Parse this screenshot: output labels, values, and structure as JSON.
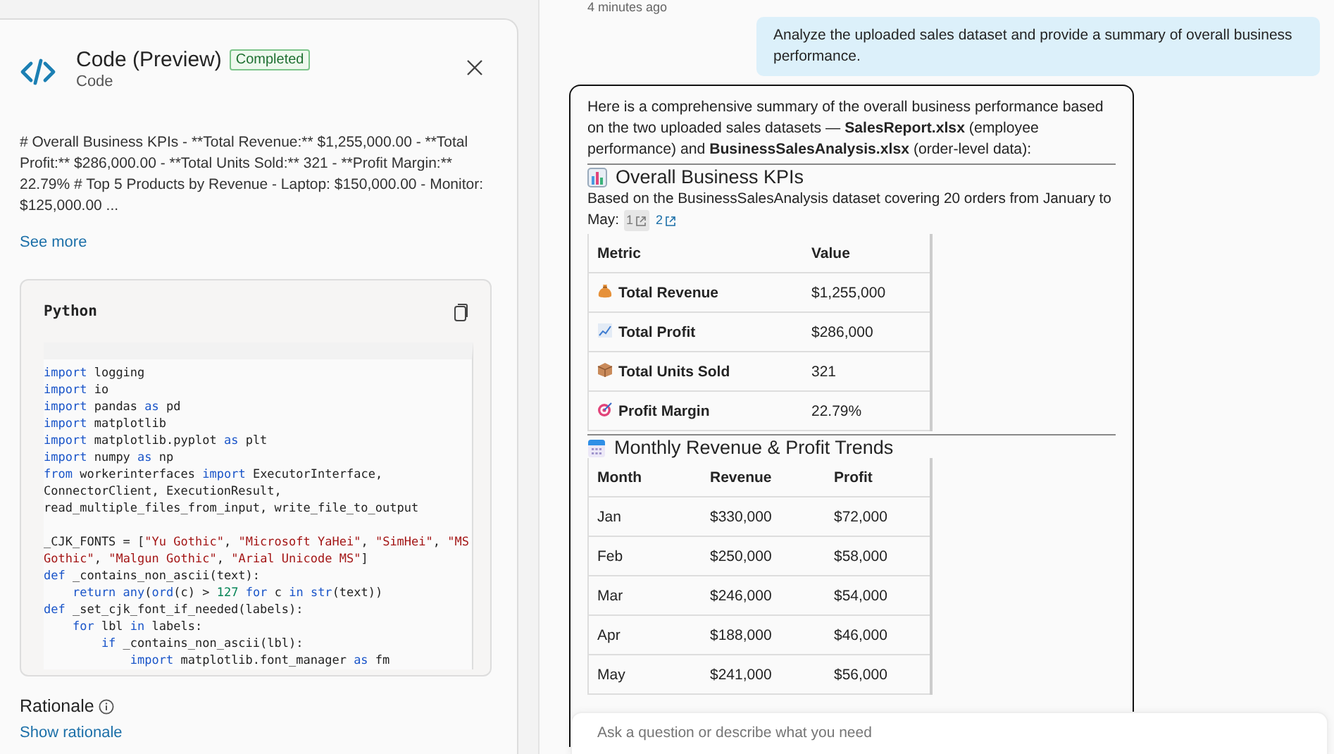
{
  "code_panel": {
    "title": "Code (Preview)",
    "status_badge": "Completed",
    "subtitle": "Code",
    "summary": "# Overall Business KPIs - **Total Revenue:** $1,255,000.00 - **Total Profit:** $286,000.00 - **Total Units Sold:** 321 - **Profit Margin:** 22.79% # Top 5 Products by Revenue - Laptop: $150,000.00 - Monitor: $125,000.00 ...",
    "see_more": "See more",
    "code_block": {
      "language": "Python",
      "lines": [
        {
          "tokens": [
            {
              "kind": "keyword",
              "text": "import"
            },
            {
              "kind": "plain",
              "text": " logging"
            }
          ]
        },
        {
          "tokens": [
            {
              "kind": "keyword",
              "text": "import"
            },
            {
              "kind": "plain",
              "text": " io"
            }
          ]
        },
        {
          "tokens": [
            {
              "kind": "keyword",
              "text": "import"
            },
            {
              "kind": "plain",
              "text": " pandas "
            },
            {
              "kind": "keyword",
              "text": "as"
            },
            {
              "kind": "plain",
              "text": " pd"
            }
          ]
        },
        {
          "tokens": [
            {
              "kind": "keyword",
              "text": "import"
            },
            {
              "kind": "plain",
              "text": " matplotlib"
            }
          ]
        },
        {
          "tokens": [
            {
              "kind": "keyword",
              "text": "import"
            },
            {
              "kind": "plain",
              "text": " matplotlib.pyplot "
            },
            {
              "kind": "keyword",
              "text": "as"
            },
            {
              "kind": "plain",
              "text": " plt"
            }
          ]
        },
        {
          "tokens": [
            {
              "kind": "keyword",
              "text": "import"
            },
            {
              "kind": "plain",
              "text": " numpy "
            },
            {
              "kind": "keyword",
              "text": "as"
            },
            {
              "kind": "plain",
              "text": " np"
            }
          ]
        },
        {
          "tokens": [
            {
              "kind": "keyword",
              "text": "from"
            },
            {
              "kind": "plain",
              "text": " workerinterfaces "
            },
            {
              "kind": "keyword",
              "text": "import"
            },
            {
              "kind": "plain",
              "text": " ExecutorInterface,"
            }
          ]
        },
        {
          "tokens": [
            {
              "kind": "plain",
              "text": "ConnectorClient, ExecutionResult,"
            }
          ]
        },
        {
          "tokens": [
            {
              "kind": "plain",
              "text": "read_multiple_files_from_input, write_file_to_output"
            }
          ]
        },
        {
          "blank_before": true,
          "tokens": [
            {
              "kind": "plain",
              "text": "_CJK_FONTS = ["
            },
            {
              "kind": "string",
              "text": "\"Yu Gothic\""
            },
            {
              "kind": "plain",
              "text": ", "
            },
            {
              "kind": "string",
              "text": "\"Microsoft YaHei\""
            },
            {
              "kind": "plain",
              "text": ", "
            },
            {
              "kind": "string",
              "text": "\"SimHei\""
            },
            {
              "kind": "plain",
              "text": ", "
            },
            {
              "kind": "string",
              "text": "\"MS"
            }
          ]
        },
        {
          "tokens": [
            {
              "kind": "string",
              "text": "Gothic\""
            },
            {
              "kind": "plain",
              "text": ", "
            },
            {
              "kind": "string",
              "text": "\"Malgun Gothic\""
            },
            {
              "kind": "plain",
              "text": ", "
            },
            {
              "kind": "string",
              "text": "\"Arial Unicode MS\""
            },
            {
              "kind": "plain",
              "text": "]"
            }
          ]
        },
        {
          "tokens": [
            {
              "kind": "keyword",
              "text": "def"
            },
            {
              "kind": "plain",
              "text": " _contains_non_ascii(text):"
            }
          ]
        },
        {
          "tokens": [
            {
              "kind": "keyword",
              "text": "    return"
            },
            {
              "kind": "keyword",
              "text": " any"
            },
            {
              "kind": "plain",
              "text": "("
            },
            {
              "kind": "keyword",
              "text": "ord"
            },
            {
              "kind": "plain",
              "text": "(c) > "
            },
            {
              "kind": "number",
              "text": "127"
            },
            {
              "kind": "keyword",
              "text": " for"
            },
            {
              "kind": "plain",
              "text": " c "
            },
            {
              "kind": "keyword",
              "text": "in"
            },
            {
              "kind": "keyword",
              "text": " str"
            },
            {
              "kind": "plain",
              "text": "(text))"
            }
          ]
        },
        {
          "tokens": [
            {
              "kind": "keyword",
              "text": "def"
            },
            {
              "kind": "plain",
              "text": " _set_cjk_font_if_needed(labels):"
            }
          ]
        },
        {
          "tokens": [
            {
              "kind": "keyword",
              "text": "    for"
            },
            {
              "kind": "plain",
              "text": " lbl "
            },
            {
              "kind": "keyword",
              "text": "in"
            },
            {
              "kind": "plain",
              "text": " labels:"
            }
          ]
        },
        {
          "tokens": [
            {
              "kind": "keyword",
              "text": "        if"
            },
            {
              "kind": "plain",
              "text": " _contains_non_ascii(lbl):"
            }
          ]
        },
        {
          "tokens": [
            {
              "kind": "keyword",
              "text": "            import"
            },
            {
              "kind": "plain",
              "text": " matplotlib.font_manager "
            },
            {
              "kind": "keyword",
              "text": "as"
            },
            {
              "kind": "plain",
              "text": " fm"
            }
          ]
        }
      ]
    },
    "rationale_heading": "Rationale",
    "show_rationale": "Show rationale"
  },
  "chat": {
    "timestamp": "4 minutes ago",
    "user_message": "Analyze the uploaded sales dataset and provide a summary of overall business performance.",
    "response": {
      "intro": "Here is a comprehensive summary of the overall business performance based on the two uploaded sales datasets — **SalesReport.xlsx** (employee performance) and **BusinessSalesAnalysis.xlsx** (order-level data):",
      "kpi_section": {
        "heading": "Overall Business KPIs",
        "description": "Based on the BusinessSalesAnalysis dataset covering 20 orders from January to May:",
        "citations": [
          {
            "label": "1",
            "selected": true
          },
          {
            "label": "2",
            "selected": false
          }
        ],
        "table": {
          "columns": [
            "Metric",
            "Value"
          ],
          "rows": [
            {
              "kind": "money",
              "metric": "Total Revenue",
              "value": "$1,255,000"
            },
            {
              "kind": "trend",
              "metric": "Total Profit",
              "value": "$286,000"
            },
            {
              "kind": "package",
              "metric": "Total Units Sold",
              "value": "321"
            },
            {
              "kind": "target",
              "metric": "Profit Margin",
              "value": "22.79%"
            }
          ]
        }
      },
      "trends_section": {
        "heading": "Monthly Revenue & Profit Trends",
        "table": {
          "columns": [
            "Month",
            "Revenue",
            "Profit"
          ],
          "rows": [
            [
              "Jan",
              "$330,000",
              "$72,000"
            ],
            [
              "Feb",
              "$250,000",
              "$58,000"
            ],
            [
              "Mar",
              "$246,000",
              "$54,000"
            ],
            [
              "Apr",
              "$188,000",
              "$46,000"
            ],
            [
              "May",
              "$241,000",
              "$56,000"
            ]
          ]
        }
      }
    },
    "input_placeholder": "Ask a question or describe what you need"
  }
}
